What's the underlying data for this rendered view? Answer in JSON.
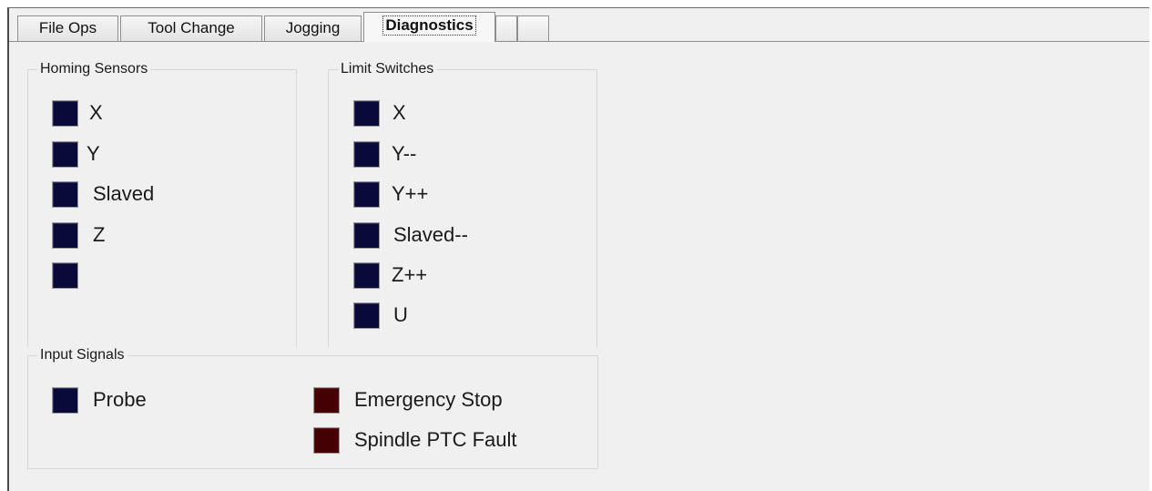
{
  "tabs": [
    {
      "label": "File Ops"
    },
    {
      "label": "Tool Change"
    },
    {
      "label": "Jogging"
    },
    {
      "label": "Diagnostics"
    },
    {
      "label": ""
    },
    {
      "label": ""
    }
  ],
  "homing": {
    "title": "Homing Sensors",
    "items": [
      {
        "label": "X",
        "color": "#0a0a3a"
      },
      {
        "label": "Y",
        "color": "#0a0a3a"
      },
      {
        "label": "Slaved",
        "color": "#0a0a3a"
      },
      {
        "label": "Z",
        "color": "#0a0a3a"
      },
      {
        "label": "",
        "color": "#0a0a3a"
      }
    ]
  },
  "limits": {
    "title": "Limit Switches",
    "items": [
      {
        "label": "X",
        "color": "#0a0a3a"
      },
      {
        "label": "Y--",
        "color": "#0a0a3a"
      },
      {
        "label": "Y++",
        "color": "#0a0a3a"
      },
      {
        "label": "Slaved--",
        "color": "#0a0a3a"
      },
      {
        "label": "Z++",
        "color": "#0a0a3a"
      },
      {
        "label": "U",
        "color": "#0a0a3a"
      }
    ]
  },
  "inputs": {
    "title": "Input Signals",
    "probe": {
      "label": "Probe",
      "color": "#0a0a3a"
    },
    "estop": {
      "label": "Emergency Stop",
      "color": "#450003"
    },
    "spindle": {
      "label": "Spindle PTC Fault",
      "color": "#450003"
    }
  }
}
